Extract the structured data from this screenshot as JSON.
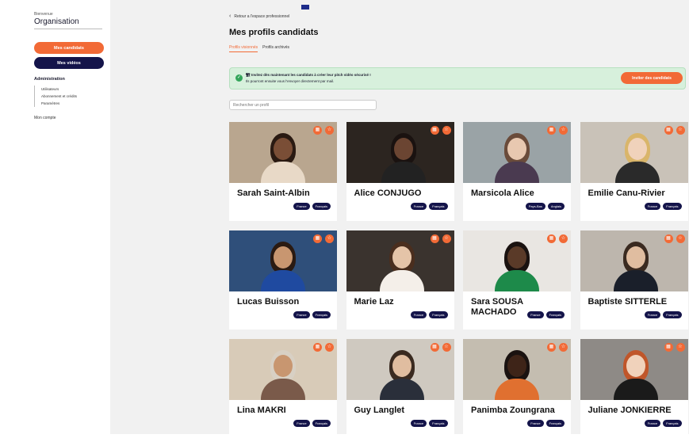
{
  "sidebar": {
    "welcome": "Bienvenue",
    "organisation": "Organisation",
    "btn_candidates": "Mes candidats",
    "btn_videos": "Mes vidéos",
    "admin_title": "Administration",
    "admin_items": [
      "Utilisateurs",
      "Abonnement et crédits",
      "Paramètres"
    ],
    "account": "Mon compte"
  },
  "header": {
    "back": "Retour a l'espace professionnel",
    "title": "Mes profils candidats",
    "tabs": [
      "Profils visionnés",
      "Profils archivés"
    ]
  },
  "banner": {
    "line1": "🏗 Invitez dès maintenant les candidats à créer leur pitch vidéo sécurisé !",
    "line2": "Ils pourront ensuite vous l'envoyer directement par mail.",
    "button": "Inviter des candidats"
  },
  "search": {
    "placeholder": "Rechercher un profil"
  },
  "icons": [
    "calendar-icon",
    "star-icon",
    "check-icon",
    "chevron-left-icon"
  ],
  "colors": {
    "accent": "#f26a36",
    "navy": "#14144a",
    "success_bg": "#d7f0dc"
  },
  "candidates": [
    {
      "name": "Sarah Saint-Albin",
      "badges": [
        "France",
        "Français"
      ]
    },
    {
      "name": "Alice CONJUGO",
      "badges": [
        "France",
        "Français"
      ]
    },
    {
      "name": "Marsicola Alice",
      "badges": [
        "Pays-Bas",
        "Anglais"
      ]
    },
    {
      "name": "Emilie Canu-Rivier",
      "badges": [
        "France",
        "Français"
      ]
    },
    {
      "name": "Lucas Buisson",
      "badges": [
        "France",
        "Français"
      ]
    },
    {
      "name": "Marie Laz",
      "badges": [
        "France",
        "Français"
      ]
    },
    {
      "name": "Sara SOUSA MACHADO",
      "badges": [
        "France",
        "Français"
      ]
    },
    {
      "name": "Baptiste SITTERLE",
      "badges": [
        "France",
        "Français"
      ]
    },
    {
      "name": "Lina MAKRI",
      "badges": [
        "France",
        "Français"
      ]
    },
    {
      "name": "Guy Langlet",
      "badges": [
        "France",
        "Français"
      ]
    },
    {
      "name": "Panimba Zoungrana",
      "badges": [
        "France",
        "Français"
      ]
    },
    {
      "name": "Juliane JONKIERRE",
      "badges": [
        "France",
        "Français"
      ]
    }
  ]
}
